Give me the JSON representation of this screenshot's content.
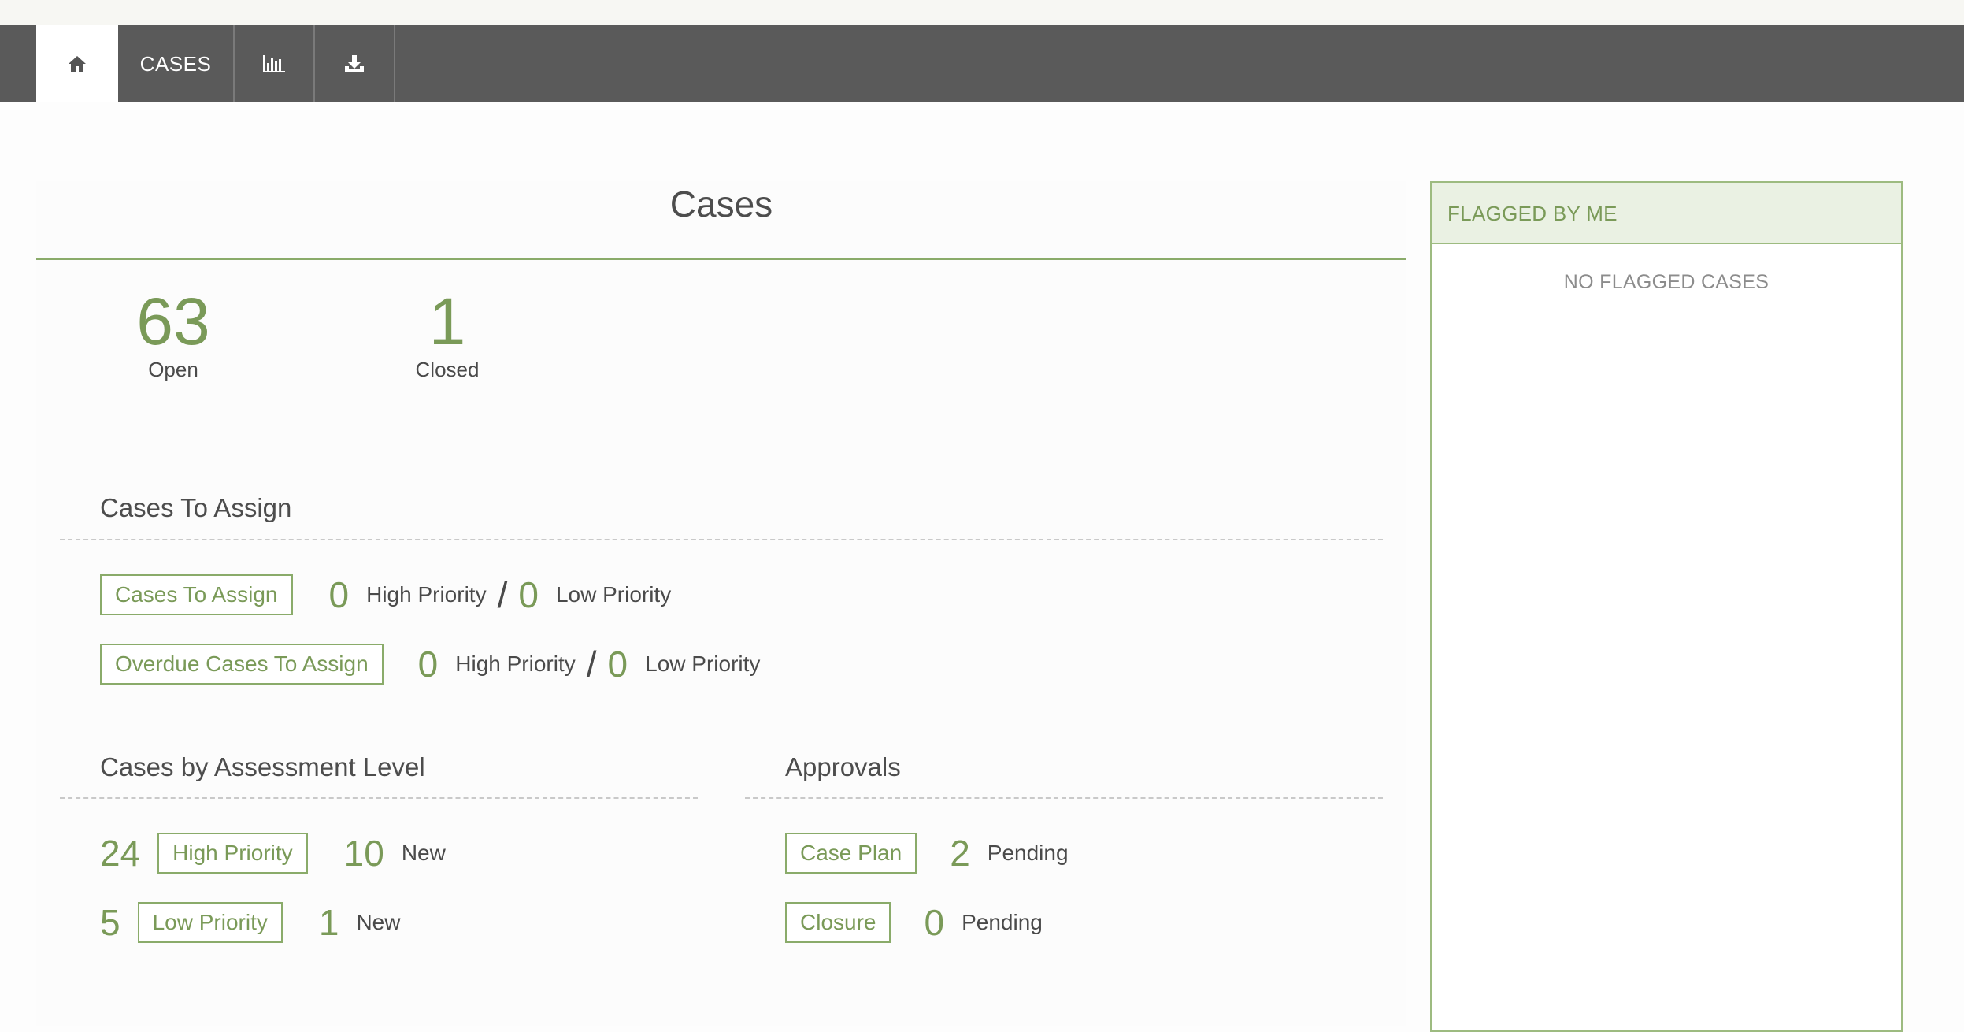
{
  "nav": {
    "home_icon": "home-icon",
    "cases_label": "CASES",
    "reports_icon": "bar-chart-icon",
    "download_icon": "download-icon"
  },
  "page": {
    "title": "Cases"
  },
  "stats": {
    "open_count": "63",
    "open_label": "Open",
    "closed_count": "1",
    "closed_label": "Closed"
  },
  "cases_to_assign": {
    "heading": "Cases To Assign",
    "rows": [
      {
        "button": "Cases To Assign",
        "high_count": "0",
        "high_label": "High Priority",
        "separator": "/",
        "low_count": "0",
        "low_label": "Low Priority"
      },
      {
        "button": "Overdue Cases To Assign",
        "high_count": "0",
        "high_label": "High Priority",
        "separator": "/",
        "low_count": "0",
        "low_label": "Low Priority"
      }
    ]
  },
  "assessment": {
    "heading": "Cases by Assessment Level",
    "rows": [
      {
        "count": "24",
        "button": "High Priority",
        "new_count": "10",
        "new_label": "New"
      },
      {
        "count": "5",
        "button": "Low Priority",
        "new_count": "1",
        "new_label": "New"
      }
    ]
  },
  "approvals": {
    "heading": "Approvals",
    "rows": [
      {
        "button": "Case Plan",
        "count": "2",
        "label": "Pending"
      },
      {
        "button": "Closure",
        "count": "0",
        "label": "Pending"
      }
    ]
  },
  "flagged": {
    "heading": "FLAGGED BY ME",
    "empty_text": "NO FLAGGED CASES"
  },
  "colors": {
    "accent_green": "#7a9a58",
    "nav_bg": "#5a5a5a",
    "flag_header_bg": "#eaf1e3"
  }
}
